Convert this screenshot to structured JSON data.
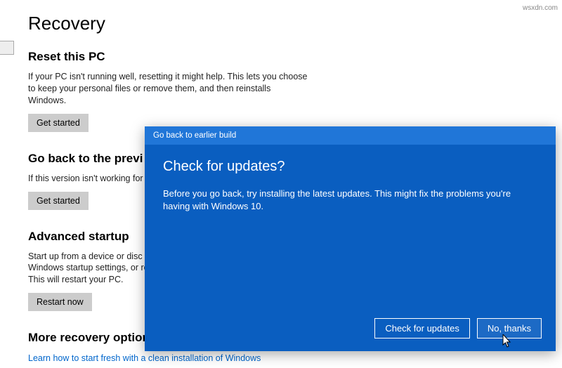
{
  "page": {
    "title": "Recovery",
    "sections": {
      "reset": {
        "title": "Reset this PC",
        "body": "If your PC isn't running well, resetting it might help. This lets you choose to keep your personal files or remove them, and then reinstalls Windows.",
        "button": "Get started"
      },
      "go_back": {
        "title": "Go back to the previ",
        "body": "If this version isn't working for",
        "button": "Get started"
      },
      "advanced": {
        "title": "Advanced startup",
        "body": "Start up from a device or disc (\nWindows startup settings, or re\nThis will restart your PC.",
        "button": "Restart now"
      },
      "more": {
        "title": "More recovery options",
        "link": "Learn how to start fresh with a clean installation of Windows"
      }
    }
  },
  "dialog": {
    "titlebar": "Go back to earlier build",
    "heading": "Check for updates?",
    "body": "Before you go back, try installing the latest updates. This might fix the problems you're having with Windows 10.",
    "buttons": {
      "check": "Check for updates",
      "no": "No, thanks"
    }
  },
  "watermark": "wsxdn.com"
}
